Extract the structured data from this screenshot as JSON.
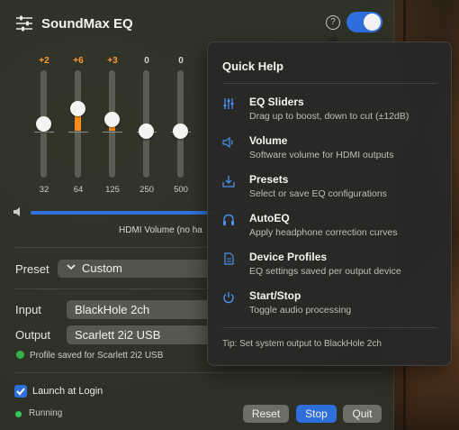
{
  "app": {
    "title": "SoundMax EQ"
  },
  "header": {
    "help_glyph": "?",
    "power_on": true
  },
  "eq": {
    "bands": [
      {
        "freq": "32",
        "gain_label": "+2",
        "gain_db": 2
      },
      {
        "freq": "64",
        "gain_label": "+6",
        "gain_db": 6
      },
      {
        "freq": "125",
        "gain_label": "+3",
        "gain_db": 3
      },
      {
        "freq": "250",
        "gain_label": "0",
        "gain_db": 0
      },
      {
        "freq": "500",
        "gain_label": "0",
        "gain_db": 0
      }
    ],
    "range_db": 12
  },
  "volume": {
    "label": "HDMI Volume (no ha",
    "level": 1.0
  },
  "preset": {
    "label": "Preset",
    "value": "Custom"
  },
  "input": {
    "label": "Input",
    "value": "BlackHole 2ch"
  },
  "output": {
    "label": "Output",
    "value": "Scarlett 2i2 USB"
  },
  "profile_status": "Profile saved for Scarlett 2i2 USB",
  "launch": {
    "label": "Launch at Login",
    "checked": true
  },
  "status": {
    "text": "Running",
    "color": "#34c759"
  },
  "buttons": {
    "reset": "Reset",
    "stop": "Stop",
    "quit": "Quit"
  },
  "colors": {
    "accent": "#2f6fdc",
    "gain": "#ff8c1a"
  },
  "help": {
    "title": "Quick Help",
    "items": [
      {
        "icon": "sliders-icon",
        "title": "EQ Sliders",
        "desc": "Drag up to boost, down to cut (±12dB)"
      },
      {
        "icon": "speaker-icon",
        "title": "Volume",
        "desc": "Software volume for HDMI outputs"
      },
      {
        "icon": "tray-download-icon",
        "title": "Presets",
        "desc": "Select or save EQ configurations"
      },
      {
        "icon": "headphones-icon",
        "title": "AutoEQ",
        "desc": "Apply headphone correction curves"
      },
      {
        "icon": "document-icon",
        "title": "Device Profiles",
        "desc": "EQ settings saved per output device"
      },
      {
        "icon": "power-icon",
        "title": "Start/Stop",
        "desc": "Toggle audio processing"
      }
    ],
    "tip": "Tip: Set system output to BlackHole 2ch"
  }
}
